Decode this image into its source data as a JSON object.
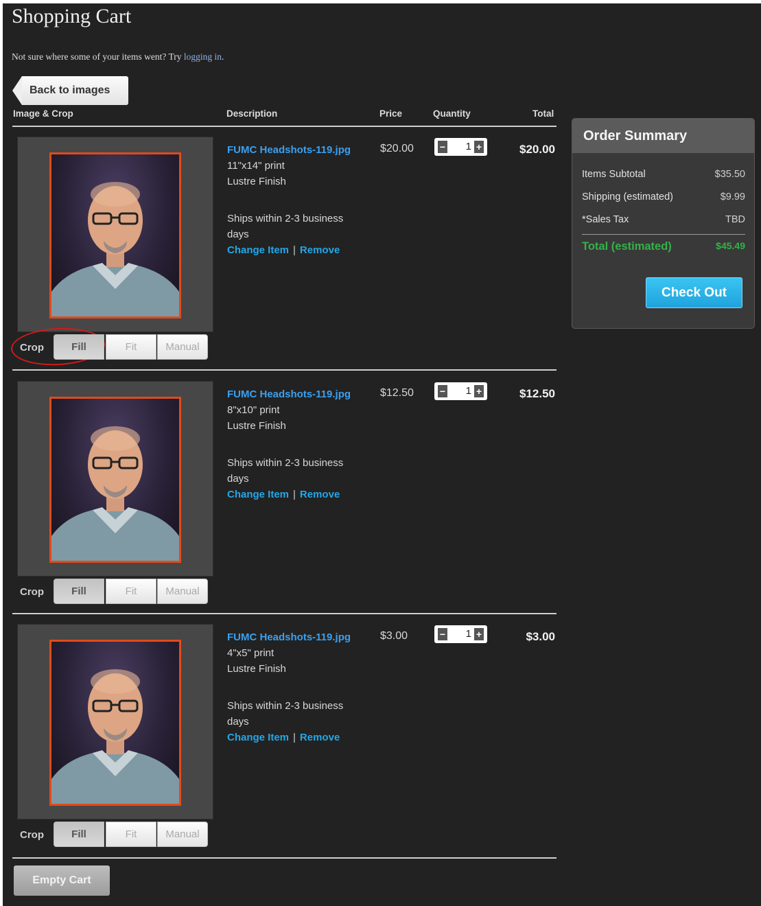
{
  "header": {
    "title": "Shopping Cart",
    "notice_text": "Not sure where some of your items went? Try ",
    "notice_link": "logging in",
    "notice_end": ".",
    "back_label": "Back to images"
  },
  "columns": {
    "image_crop": "Image & Crop",
    "description": "Description",
    "price": "Price",
    "quantity": "Quantity",
    "total": "Total"
  },
  "items": [
    {
      "filename": "FUMC Headshots-119.jpg",
      "size": "11\"x14\" print",
      "finish": "Lustre Finish",
      "shipping": "Ships within 2-3 business days",
      "change_label": "Change Item",
      "separator": "|",
      "remove_label": "Remove",
      "price": "$20.00",
      "quantity": "1",
      "total": "$20.00",
      "crop_label": "Crop",
      "crop_options": [
        "Fill",
        "Fit",
        "Manual"
      ]
    },
    {
      "filename": "FUMC Headshots-119.jpg",
      "size": "8\"x10\" print",
      "finish": "Lustre Finish",
      "shipping": "Ships within 2-3 business days",
      "change_label": "Change Item",
      "separator": "|",
      "remove_label": "Remove",
      "price": "$12.50",
      "quantity": "1",
      "total": "$12.50",
      "crop_label": "Crop",
      "crop_options": [
        "Fill",
        "Fit",
        "Manual"
      ]
    },
    {
      "filename": "FUMC Headshots-119.jpg",
      "size": "4\"x5\" print",
      "finish": "Lustre Finish",
      "shipping": "Ships within 2-3 business days",
      "change_label": "Change Item",
      "separator": "|",
      "remove_label": "Remove",
      "price": "$3.00",
      "quantity": "1",
      "total": "$3.00",
      "crop_label": "Crop",
      "crop_options": [
        "Fill",
        "Fit",
        "Manual"
      ]
    }
  ],
  "summary": {
    "title": "Order Summary",
    "rows": [
      {
        "label": "Items Subtotal",
        "value": "$35.50"
      },
      {
        "label": "Shipping (estimated)",
        "value": "$9.99"
      },
      {
        "label": "*Sales Tax",
        "value": "TBD"
      }
    ],
    "total_label": "Total (estimated)",
    "total_value": "$45.49",
    "checkout_label": "Check Out"
  },
  "empty_cart_label": "Empty Cart",
  "colors": {
    "accent_link": "#22a7e8",
    "checkout": "#2bb5ea",
    "total_green": "#35b149",
    "photo_border": "#e24a1a",
    "annotation_circle": "#d21a1a"
  },
  "icons": {
    "qty_minus": "minus-icon",
    "qty_plus": "plus-icon",
    "back": "arrow-left-icon"
  }
}
